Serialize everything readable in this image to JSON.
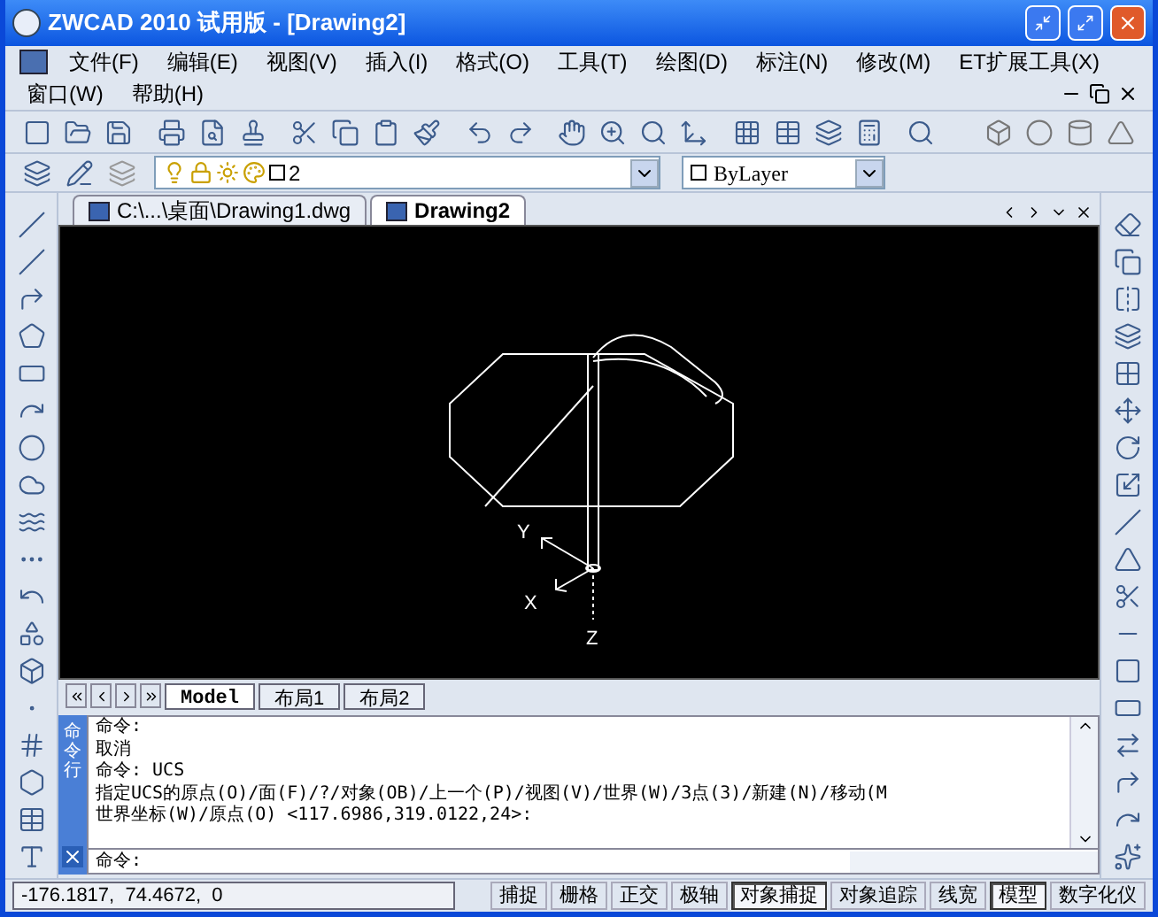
{
  "window": {
    "title": "ZWCAD 2010 试用版 - [Drawing2]"
  },
  "menu_rows": [
    [
      "文件(F)",
      "编辑(E)",
      "视图(V)",
      "插入(I)",
      "格式(O)",
      "工具(T)",
      "绘图(D)",
      "标注(N)",
      "修改(M)",
      "ET扩展工具(X)"
    ],
    [
      "窗口(W)",
      "帮助(H)"
    ]
  ],
  "layer_bar": {
    "layer": "2",
    "linetype": "ByLayer"
  },
  "drawing_tabs": [
    {
      "label": "C:\\...\\桌面\\Drawing1.dwg",
      "selected": false
    },
    {
      "label": "Drawing2",
      "selected": true
    }
  ],
  "canvas": {
    "axis_labels": [
      "Y",
      "X",
      "Z"
    ]
  },
  "layout_tabs": [
    {
      "label": "Model",
      "selected": true
    },
    {
      "label": "布局1",
      "selected": false
    },
    {
      "label": "布局2",
      "selected": false
    }
  ],
  "command_panel": {
    "side_label": "命令行",
    "history": [
      "命令:",
      "取消",
      "命令: UCS",
      "指定UCS的原点(O)/面(F)/?/对象(OB)/上一个(P)/视图(V)/世界(W)/3点(3)/新建(N)/移动(M",
      "世界坐标(W)/原点(O) <117.6986,319.0122,24>:"
    ],
    "prompt": "命令:"
  },
  "status_bar": {
    "coordinates": "-176.1817,  74.4672,  0",
    "toggles": [
      {
        "label": "捕捉",
        "on": false
      },
      {
        "label": "栅格",
        "on": false
      },
      {
        "label": "正交",
        "on": false
      },
      {
        "label": "极轴",
        "on": false
      },
      {
        "label": "对象捕捉",
        "on": true
      },
      {
        "label": "对象追踪",
        "on": false
      },
      {
        "label": "线宽",
        "on": false
      },
      {
        "label": "模型",
        "on": true
      },
      {
        "label": "数字化仪",
        "on": false
      }
    ]
  }
}
